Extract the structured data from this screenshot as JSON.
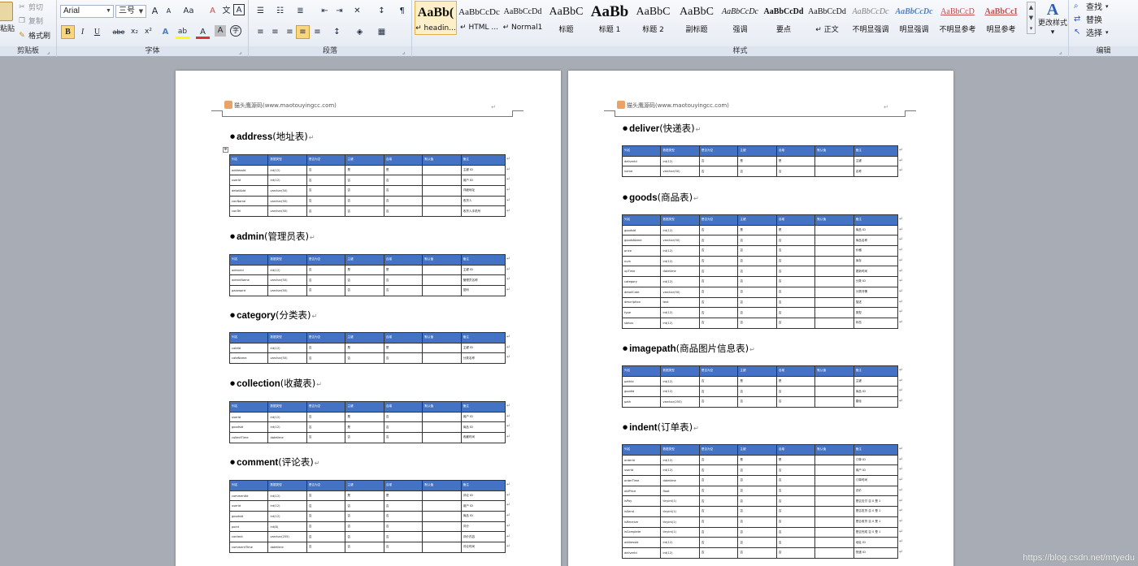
{
  "ribbon": {
    "clipboard": {
      "paste": "粘贴",
      "cut": "剪切",
      "copy": "复制",
      "format_painter": "格式刷",
      "label": "剪贴板"
    },
    "font": {
      "font_name": "Arial",
      "font_size": "三号",
      "grow": "A",
      "shrink": "A",
      "case": "Aa",
      "clear": "A",
      "phonetic": "文",
      "border": "A",
      "bold": "B",
      "italic": "I",
      "underline": "U",
      "strike": "abe",
      "subscript": "x₂",
      "superscript": "x²",
      "effects": "A",
      "highlight": "ab",
      "color": "A",
      "shade": "A",
      "enclose": "字",
      "label": "字体"
    },
    "paragraph": {
      "label": "段落"
    },
    "styles": {
      "label": "样式",
      "tiles": [
        {
          "preview": "AaBb(",
          "name": "↵ headin...",
          "selected": true,
          "size": 16,
          "bold": true
        },
        {
          "preview": "AaBbCcDc",
          "name": "↵ HTML ...",
          "selected": false,
          "size": 11,
          "bold": false
        },
        {
          "preview": "AaBbCcDd",
          "name": "↵ Normal1",
          "selected": false,
          "size": 10,
          "bold": false
        },
        {
          "preview": "AaBbC",
          "name": "标题",
          "selected": false,
          "size": 14,
          "bold": false
        },
        {
          "preview": "AaBb",
          "name": "标题 1",
          "selected": false,
          "size": 19,
          "bold": true
        },
        {
          "preview": "AaBbC",
          "name": "标题 2",
          "selected": false,
          "size": 14,
          "bold": false
        },
        {
          "preview": "AaBbC",
          "name": "副标题",
          "selected": false,
          "size": 14,
          "bold": false
        },
        {
          "preview": "AaBbCcDc",
          "name": "强调",
          "selected": false,
          "size": 10,
          "bold": false,
          "italic": true
        },
        {
          "preview": "AaBbCcDd",
          "name": "要点",
          "selected": false,
          "size": 10,
          "bold": true
        },
        {
          "preview": "AaBbCcDd",
          "name": "↵ 正文",
          "selected": false,
          "size": 10,
          "bold": false
        },
        {
          "preview": "AaBbCcDc",
          "name": "不明显强调",
          "selected": false,
          "size": 10,
          "bold": false,
          "italic": true,
          "color": "#7f7f7f"
        },
        {
          "preview": "AaBbCcDc",
          "name": "明显强调",
          "selected": false,
          "size": 10,
          "bold": true,
          "italic": true,
          "color": "#4f81bd"
        },
        {
          "preview": "AaBbCcD",
          "name": "不明显参考",
          "selected": false,
          "size": 10,
          "bold": false,
          "color": "#c0504d",
          "underline": true
        },
        {
          "preview": "AaBbCcI",
          "name": "明显参考",
          "selected": false,
          "size": 10,
          "bold": true,
          "color": "#c0504d",
          "underline": true
        }
      ],
      "change_styles": "更改样式"
    },
    "editing": {
      "find": "查找",
      "replace": "替换",
      "select": "选择",
      "label": "编辑"
    }
  },
  "doc": {
    "header_text": "猫头鹰源码(www.maotouyingcc.com)",
    "column_headers": [
      "列名",
      "数据类型",
      "是否为空",
      "主键",
      "自增",
      "默认值",
      "备注"
    ],
    "pages": [
      {
        "sections": [
          {
            "name": "address",
            "cn": "(地址表)",
            "rows": [
              [
                "addressId",
                "int(12)",
                "否",
                "是",
                "是",
                "",
                "主键 ID"
              ],
              [
                "userId",
                "int(12)",
                "否",
                "否",
                "否",
                "",
                "用户 ID"
              ],
              [
                "detailAdd",
                "varchar(50)",
                "否",
                "否",
                "否",
                "",
                "详细地址"
              ],
              [
                "conName",
                "varchar(50)",
                "否",
                "否",
                "否",
                "",
                "收货人"
              ],
              [
                "conTel",
                "varchar(50)",
                "否",
                "否",
                "否",
                "",
                "收货人手机号"
              ]
            ]
          },
          {
            "name": "admin",
            "cn": "(管理员表)",
            "rows": [
              [
                "adminId",
                "int(12)",
                "否",
                "是",
                "是",
                "",
                "主键 ID"
              ],
              [
                "adminName",
                "varchar(50)",
                "否",
                "否",
                "否",
                "",
                "管理员名称"
              ],
              [
                "password",
                "varchar(50)",
                "否",
                "否",
                "否",
                "",
                "密码"
              ]
            ]
          },
          {
            "name": "category",
            "cn": "(分类表)",
            "rows": [
              [
                "cateId",
                "int(12)",
                "否",
                "是",
                "是",
                "",
                "主键 ID"
              ],
              [
                "cateName",
                "varchar(50)",
                "否",
                "否",
                "否",
                "",
                "分类名称"
              ]
            ]
          },
          {
            "name": "collection",
            "cn": "(收藏表)",
            "rows": [
              [
                "userId",
                "int(12)",
                "否",
                "是",
                "否",
                "",
                "用户 ID"
              ],
              [
                "goodsId",
                "int(12)",
                "否",
                "是",
                "否",
                "",
                "商品 ID"
              ],
              [
                "collectTime",
                "datetime",
                "否",
                "否",
                "否",
                "",
                "收藏时间"
              ]
            ]
          },
          {
            "name": "comment",
            "cn": "(评论表)",
            "rows": [
              [
                "commentId",
                "int(12)",
                "否",
                "是",
                "是",
                "",
                "评论 ID"
              ],
              [
                "userId",
                "int(12)",
                "否",
                "否",
                "否",
                "",
                "用户 ID"
              ],
              [
                "goodsId",
                "int(12)",
                "否",
                "否",
                "否",
                "",
                "商品 ID"
              ],
              [
                "point",
                "int(8)",
                "否",
                "否",
                "否",
                "",
                "评分"
              ],
              [
                "content",
                "varchar(255)",
                "否",
                "否",
                "否",
                "",
                "评价内容"
              ],
              [
                "commentTime",
                "datetime",
                "否",
                "否",
                "否",
                "",
                "评论时间"
              ]
            ]
          }
        ]
      },
      {
        "sections": [
          {
            "name": "deliver",
            "cn": "(快递表)",
            "rows": [
              [
                "deliverId",
                "int(12)",
                "否",
                "是",
                "是",
                "",
                "主键"
              ],
              [
                "name",
                "varchar(50)",
                "否",
                "否",
                "否",
                "",
                "名称"
              ]
            ]
          },
          {
            "name": "goods",
            "cn": "(商品表)",
            "rows": [
              [
                "goodsId",
                "int(12)",
                "否",
                "是",
                "是",
                "",
                "商品 ID"
              ],
              [
                "goodsName",
                "varchar(50)",
                "否",
                "否",
                "否",
                "",
                "商品名称"
              ],
              [
                "price",
                "int(12)",
                "否",
                "否",
                "否",
                "",
                "价格"
              ],
              [
                "num",
                "int(12)",
                "否",
                "否",
                "否",
                "",
                "库存"
              ],
              [
                "upTime",
                "datetime",
                "否",
                "否",
                "否",
                "",
                "更新时间"
              ],
              [
                "category",
                "int(12)",
                "否",
                "否",
                "否",
                "",
                "分类 ID"
              ],
              [
                "detailCate",
                "varchar(50)",
                "否",
                "否",
                "否",
                "",
                "分类详情"
              ],
              [
                "description",
                "text",
                "否",
                "否",
                "否",
                "",
                "描述"
              ],
              [
                "type",
                "int(12)",
                "否",
                "否",
                "否",
                "",
                "类型"
              ],
              [
                "status",
                "int(12)",
                "否",
                "否",
                "否",
                "",
                "状态"
              ]
            ]
          },
          {
            "name": "imagepath",
            "cn": "(商品图片信息表)",
            "rows": [
              [
                "pathId",
                "int(12)",
                "否",
                "是",
                "是",
                "",
                "主键"
              ],
              [
                "goodId",
                "int(12)",
                "否",
                "否",
                "否",
                "",
                "商品 ID"
              ],
              [
                "path",
                "varchar(255)",
                "否",
                "否",
                "否",
                "",
                "路径"
              ]
            ]
          },
          {
            "name": "indent",
            "cn": "(订单表)",
            "rows": [
              [
                "orderId",
                "int(12)",
                "否",
                "是",
                "是",
                "",
                "订单 ID"
              ],
              [
                "userId",
                "int(12)",
                "否",
                "否",
                "否",
                "",
                "用户 ID"
              ],
              [
                "orderTime",
                "datetime",
                "否",
                "否",
                "否",
                "",
                "订单时间"
              ],
              [
                "oldPrice",
                "float",
                "否",
                "否",
                "否",
                "",
                "总价"
              ],
              [
                "isPay",
                "tinyint(1)",
                "否",
                "否",
                "否",
                "",
                "是否支付 否 0 是 1"
              ],
              [
                "isSend",
                "tinyint(1)",
                "否",
                "否",
                "否",
                "",
                "是否发货 否 0 是 1"
              ],
              [
                "isReceive",
                "tinyint(1)",
                "否",
                "否",
                "否",
                "",
                "是否收货 否 0 是 1"
              ],
              [
                "isComplete",
                "tinyint(1)",
                "否",
                "否",
                "否",
                "",
                "是否完成 否 0 是 1"
              ],
              [
                "addressId",
                "int(12)",
                "否",
                "否",
                "否",
                "",
                "地址 ID"
              ],
              [
                "deliverId",
                "int(12)",
                "否",
                "否",
                "否",
                "",
                "快递 ID"
              ]
            ]
          }
        ]
      }
    ]
  },
  "watermark": "https://blog.csdn.net/mtyedu"
}
